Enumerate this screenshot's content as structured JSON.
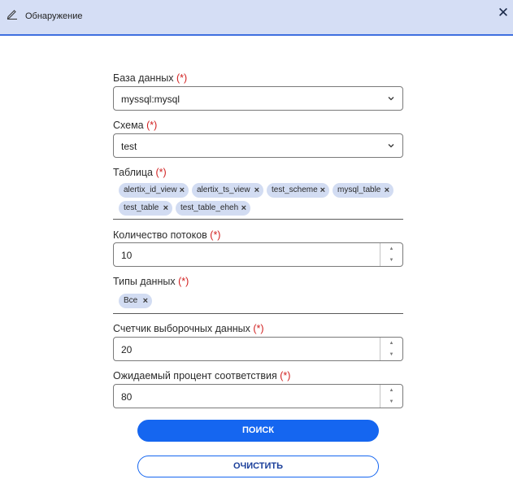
{
  "window": {
    "title": "Обнаружение",
    "title_icon": "pencil-icon",
    "close_symbol": "✕"
  },
  "form": {
    "required_mark": "(*)",
    "database": {
      "label": "База данных",
      "value": "myssql:mysql"
    },
    "schema": {
      "label": "Схема",
      "value": "test"
    },
    "table": {
      "label": "Таблица",
      "chips": [
        "alertix_id_view",
        "alertix_ts_view",
        "test_scheme",
        "mysql_table",
        "test_table",
        "test_table_eheh"
      ]
    },
    "threads": {
      "label": "Количество потоков",
      "value": "10"
    },
    "data_types": {
      "label": "Типы данных",
      "chips": [
        "Все"
      ]
    },
    "sample_counter": {
      "label": "Счетчик выборочных данных",
      "value": "20"
    },
    "match_percent": {
      "label": "Ожидаемый процент соответствия",
      "value": "80"
    }
  },
  "chip_remove_symbol": "×",
  "buttons": {
    "search": "ПОИСК",
    "clear": "ОЧИСТИТЬ"
  },
  "colors": {
    "accent": "#1566f0",
    "titlebar_bg": "#d5def5",
    "chip_bg": "#d2dcf2",
    "required": "#d11f1f"
  }
}
